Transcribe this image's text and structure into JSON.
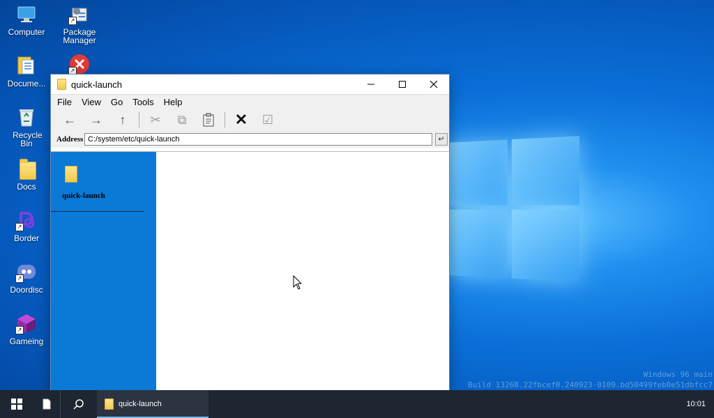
{
  "desktop": {
    "icons": [
      {
        "label": "Computer",
        "icon": "computer-icon"
      },
      {
        "label": "Package Manager",
        "icon": "package-manager-icon"
      },
      {
        "label": "Docume...",
        "icon": "documents-icon"
      },
      {
        "label": "",
        "icon": "error-icon"
      },
      {
        "label": "Recycle Bin",
        "icon": "recycle-bin-icon"
      },
      {
        "label": "Docs",
        "icon": "folder-icon"
      },
      {
        "label": "Border",
        "icon": "border-app-icon"
      },
      {
        "label": "Doordisc",
        "icon": "doordisc-icon"
      },
      {
        "label": "Gameing",
        "icon": "gameing-icon"
      }
    ],
    "watermark": {
      "line1": "Windows 96 main",
      "line2": "Build 13268.22fbcef0.240923-0109.bd50499feb0e51dbfcc7"
    }
  },
  "window": {
    "title": "quick-launch",
    "menu": [
      "File",
      "View",
      "Go",
      "Tools",
      "Help"
    ],
    "toolbar": {
      "back": "←",
      "forward": "→",
      "up": "↑",
      "cut": "✂",
      "copy": "⧉",
      "paste": "📋",
      "delete": "✕",
      "select": "☑"
    },
    "address": {
      "label": "Address",
      "value": "C:/system/etc/quick-launch",
      "go": "↵"
    },
    "sidepanel": {
      "folder_name": "quick-launch"
    }
  },
  "taskbar": {
    "task_label": "quick-launch",
    "clock": "10:01"
  }
}
